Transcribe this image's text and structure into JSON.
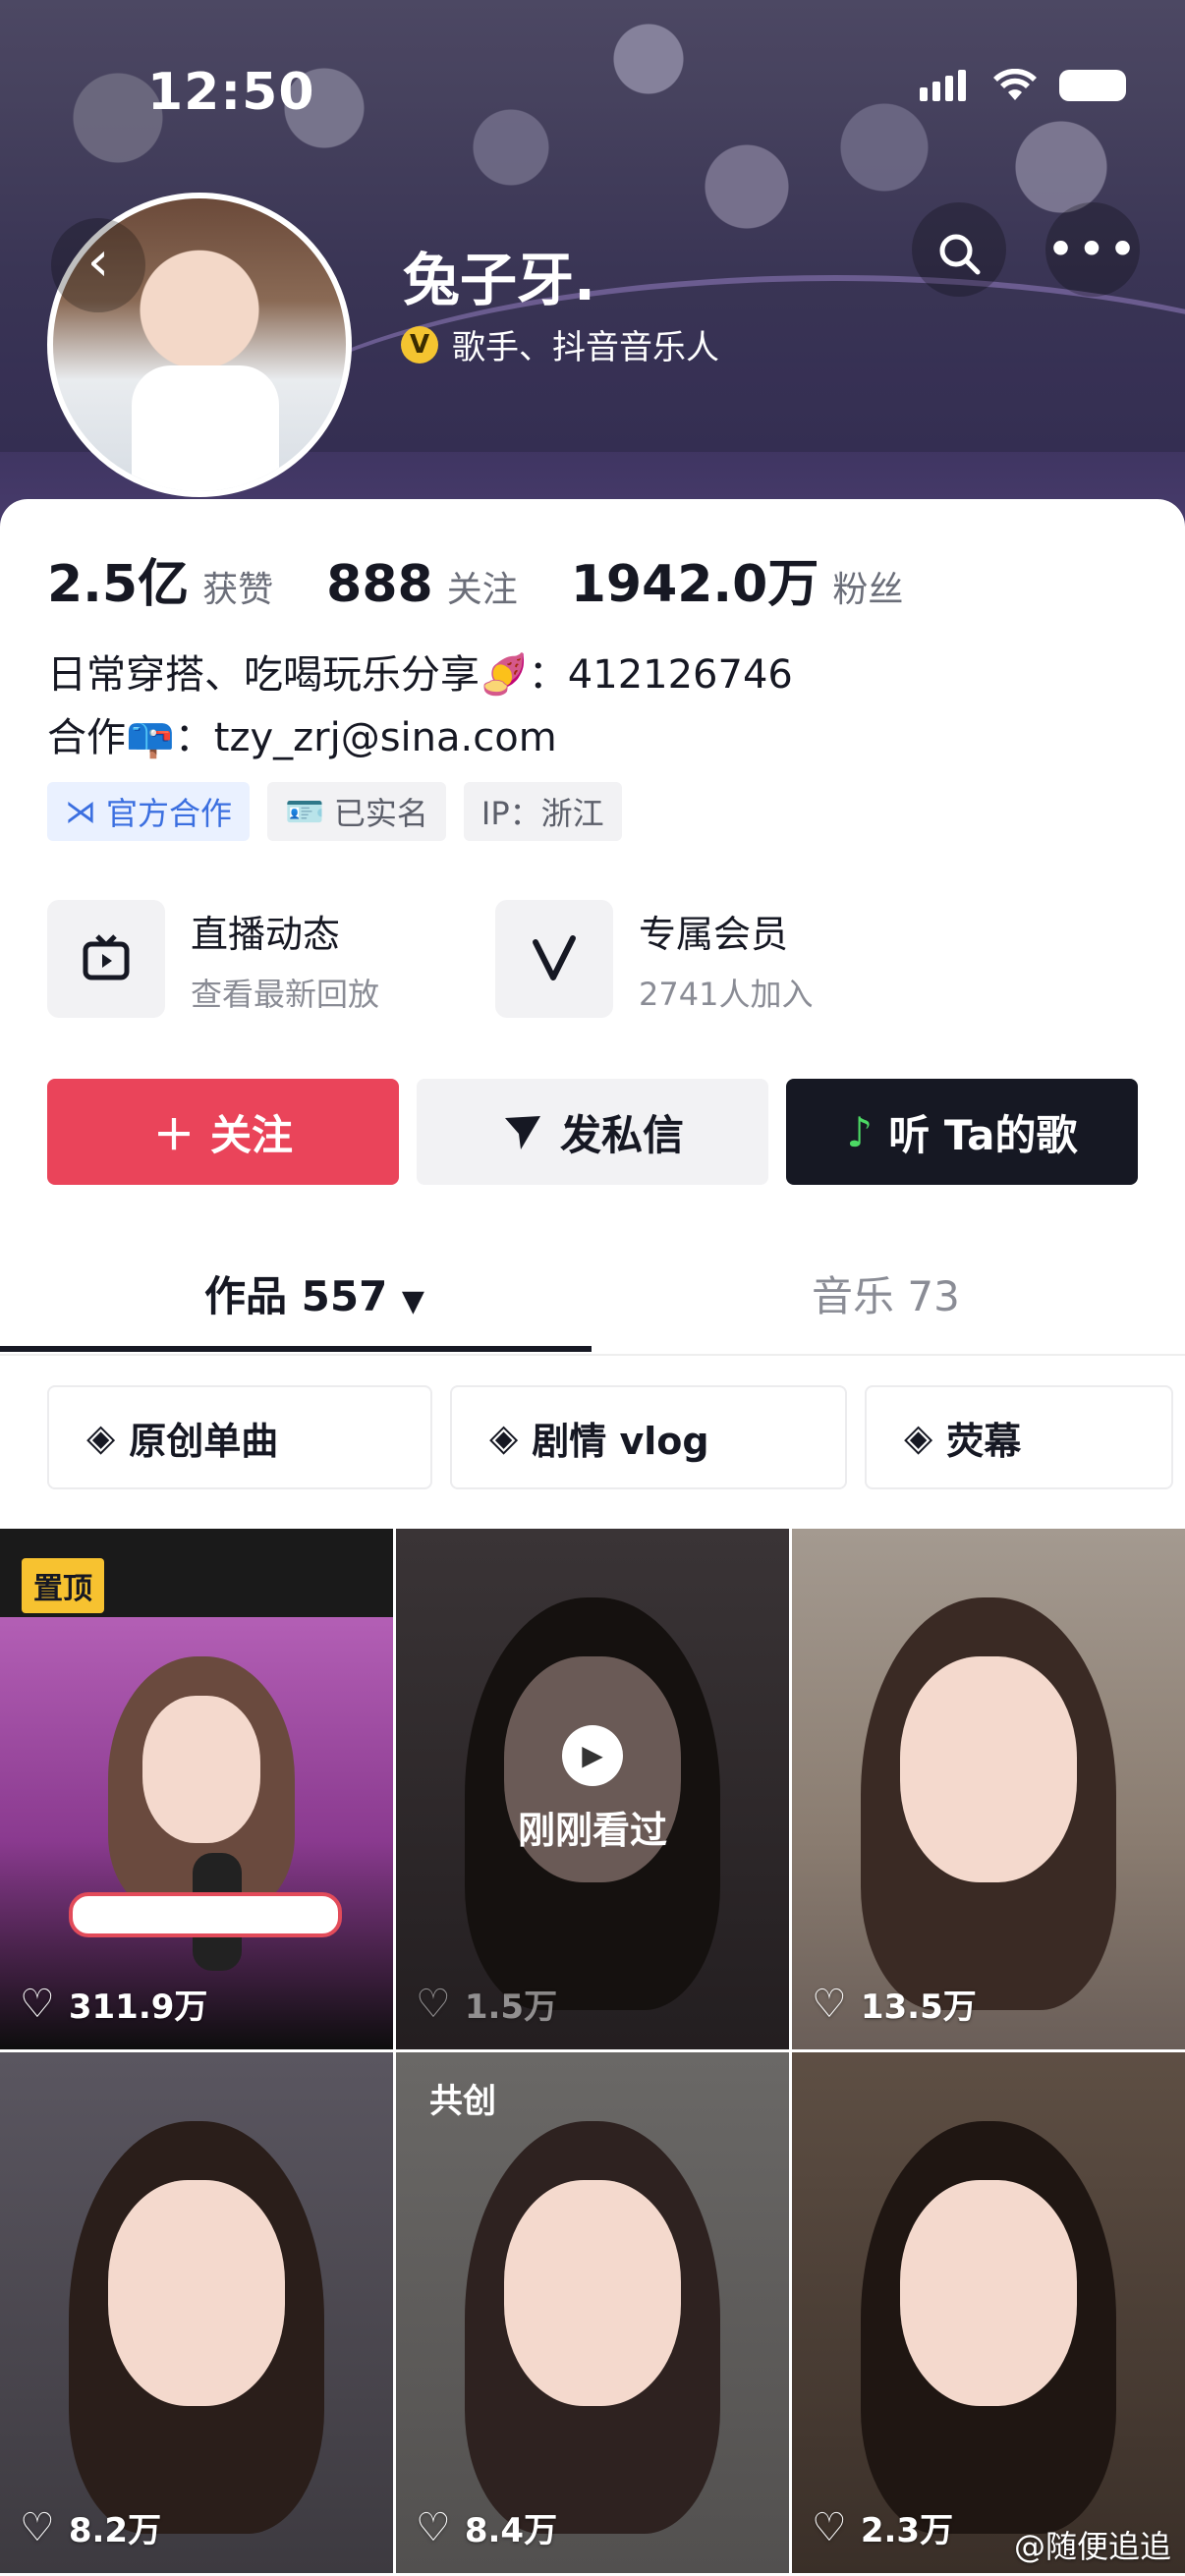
{
  "status_bar": {
    "time": "12:50"
  },
  "profile": {
    "nickname": "兔子牙.",
    "verify_label": "歌手、抖音音乐人",
    "verify_badge": "V",
    "stats": [
      {
        "num": "2.5亿",
        "label": "获赞"
      },
      {
        "num": "888",
        "label": "关注"
      },
      {
        "num": "1942.0万",
        "label": "粉丝"
      }
    ],
    "bio_line1": "日常穿搭、吃喝玩乐分享🍠：412126746",
    "bio_line2": "合作📪：tzy_zrj@sina.com",
    "tags": [
      "官方合作",
      "已实名",
      "IP：浙江"
    ]
  },
  "features": [
    {
      "title": "直播动态",
      "subtitle": "查看最新回放",
      "icon": "tv-icon"
    },
    {
      "title": "专属会员",
      "subtitle": "2741人加入",
      "icon": "vip-v-icon"
    }
  ],
  "actions": {
    "follow": "关注",
    "message": "发私信",
    "listen": "听 Ta的歌"
  },
  "tabs": {
    "works": "作品 557",
    "music": "音乐 73"
  },
  "collections": [
    "原创单曲",
    "剧情 vlog",
    "荧幕"
  ],
  "grid": [
    {
      "likes": "311.9万",
      "pinned": "置顶",
      "palette": "#8a3a8f"
    },
    {
      "likes": "1.5万",
      "watched": "刚刚看过",
      "palette": "#2a2426"
    },
    {
      "likes": "13.5万",
      "palette": "#7a6a62"
    },
    {
      "likes": "8.2万",
      "palette": "#3d3a40"
    },
    {
      "likes": "8.4万",
      "tagline": "共创",
      "palette": "#52504f"
    },
    {
      "likes": "2.3万",
      "palette": "#4d3f36"
    }
  ],
  "watermark": "@随便追追"
}
